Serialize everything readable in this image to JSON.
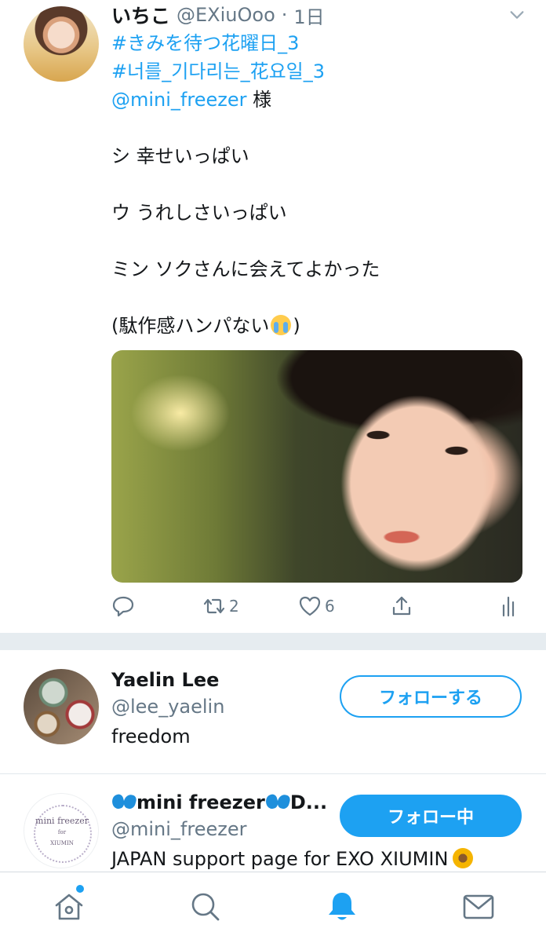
{
  "tweet": {
    "display_name": "いちこ",
    "handle": "@EXiuOoo",
    "separator": "·",
    "time": "1日",
    "lines": [
      {
        "text": "#きみを待つ花曜日_3",
        "link": true
      },
      {
        "text": "#너를_기다리는_花요일_3",
        "link": true
      },
      {
        "mention": "@mini_freezer",
        "suffix": " 様"
      },
      {
        "text": "シ 幸せいっぱい"
      },
      {
        "text": "ウ うれしさいっぱい"
      },
      {
        "text": "ミン ソクさんに会えてよかった"
      },
      {
        "text_before": "(駄作感ハンパない",
        "text_after": ")"
      }
    ],
    "retweet_count": "2",
    "like_count": "6"
  },
  "who_to_follow": [
    {
      "name": "Yaelin Lee",
      "handle": "@lee_yaelin",
      "bio": "freedom",
      "button": "フォローする"
    },
    {
      "name": "mini freezer",
      "name_suffix": "D...",
      "handle": "@mini_freezer",
      "bio": "JAPAN support page for EXO XIUMIN",
      "button": "フォロー中",
      "avatar_text": {
        "line1": "mini freezer",
        "line2": "for",
        "line3": "XIUMIN"
      }
    }
  ],
  "colors": {
    "accent": "#1da1f2",
    "muted": "#657786",
    "text": "#14171a",
    "separator": "#e6ecf0"
  },
  "icons": {
    "caret": "chevron-down-icon",
    "reply": "reply-icon",
    "retweet": "retweet-icon",
    "like": "heart-icon",
    "share": "share-icon",
    "analytics": "analytics-icon",
    "home": "home-icon",
    "search": "search-icon",
    "notifications": "bell-icon",
    "messages": "mail-icon"
  },
  "tabbar": {
    "active": "notifications"
  }
}
